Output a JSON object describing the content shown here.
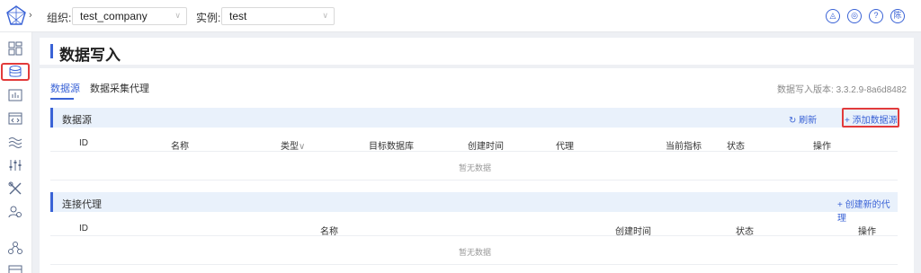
{
  "topbar": {
    "org_label": "组织:",
    "org_value": "test_company",
    "instance_label": "实例:",
    "instance_value": "test",
    "right_icons": [
      "notification-icon",
      "settings-icon",
      "help-icon",
      "user-avatar"
    ],
    "user_initial": "陈"
  },
  "sidebar": {
    "items": [
      "dashboard-icon",
      "data-ingest-icon",
      "chart-icon",
      "code-icon",
      "stream-icon",
      "tuning-icon",
      "tools-icon",
      "user-manage-icon",
      "graph-icon",
      "layout-icon"
    ],
    "active_index": 1
  },
  "page": {
    "title": "数据写入",
    "tabs": [
      "数据源",
      "数据采集代理"
    ],
    "active_tab": 0,
    "version": "数据写入版本: 3.3.2.9-8a6d8482"
  },
  "datasource": {
    "title": "数据源",
    "refresh": "刷新",
    "add": "+ 添加数据源",
    "columns": [
      "ID",
      "名称",
      "类型",
      "目标数据库",
      "创建时间",
      "代理",
      "当前指标",
      "状态",
      "操作"
    ],
    "empty": "暂无数据"
  },
  "proxy": {
    "title": "连接代理",
    "add": "+ 创建新的代理",
    "columns": [
      "ID",
      "名称",
      "创建时间",
      "状态",
      "操作"
    ],
    "empty": "暂无数据"
  },
  "colors": {
    "accent": "#3a63d6",
    "highlight": "#e23b3b",
    "panel_bg": "#e9f1fb"
  }
}
